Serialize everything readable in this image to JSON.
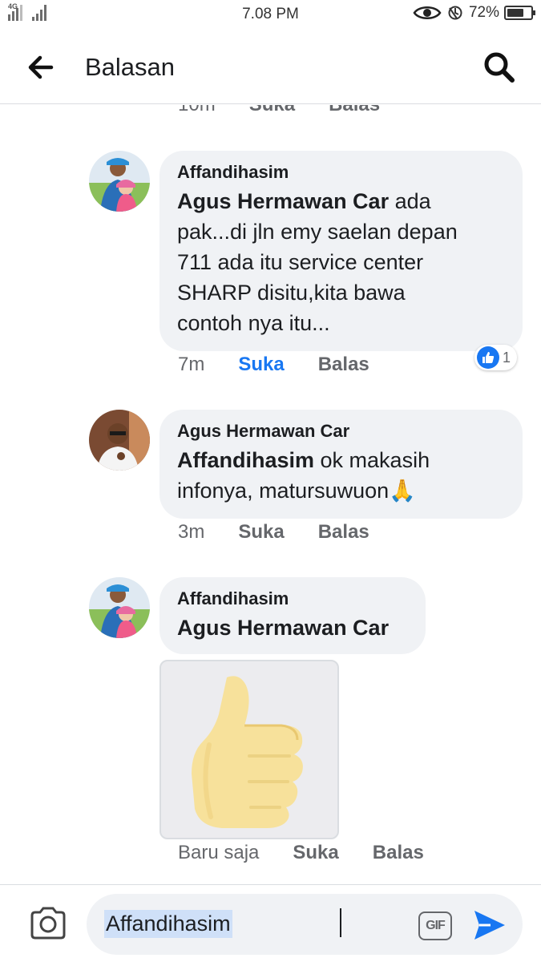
{
  "status_bar": {
    "network": "4G",
    "time": "7.08 PM",
    "battery": "72%",
    "battery_level": 0.72
  },
  "header": {
    "title": "Balasan",
    "back_icon": "arrow-left-icon",
    "search_icon": "search-icon"
  },
  "colors": {
    "accent": "#1877f2",
    "bubble": "#f0f2f5",
    "meta_text": "#65676b"
  },
  "previous_meta": {
    "time": "10m",
    "like": "Suka",
    "reply": "Balas"
  },
  "comments": [
    {
      "author": "Affandihasim",
      "mention": "Agus Hermawan Car",
      "line1_rest": " ada",
      "lines": [
        "pak...di jln emy saelan depan",
        "711 ada itu service center",
        "SHARP disitu,kita bawa",
        "contoh nya itu..."
      ],
      "time": "7m",
      "like": "Suka",
      "reply": "Balas",
      "liked": true,
      "reaction_count": "1"
    },
    {
      "author": "Agus Hermawan Car",
      "mention": "Affandihasim",
      "line1_rest": " ok makasih",
      "lines": [
        "infonya,  matursuwuon🙏"
      ],
      "time": "3m",
      "like": "Suka",
      "reply": "Balas"
    },
    {
      "author": "Affandihasim",
      "mention": "Agus Hermawan Car",
      "sticker": "thumbs-up-sticker",
      "time": "Baru saja",
      "like": "Suka",
      "reply": "Balas"
    }
  ],
  "composer": {
    "value": "Affandihasim",
    "camera_icon": "camera-icon",
    "gif_label": "GIF",
    "send_icon": "send-icon"
  }
}
